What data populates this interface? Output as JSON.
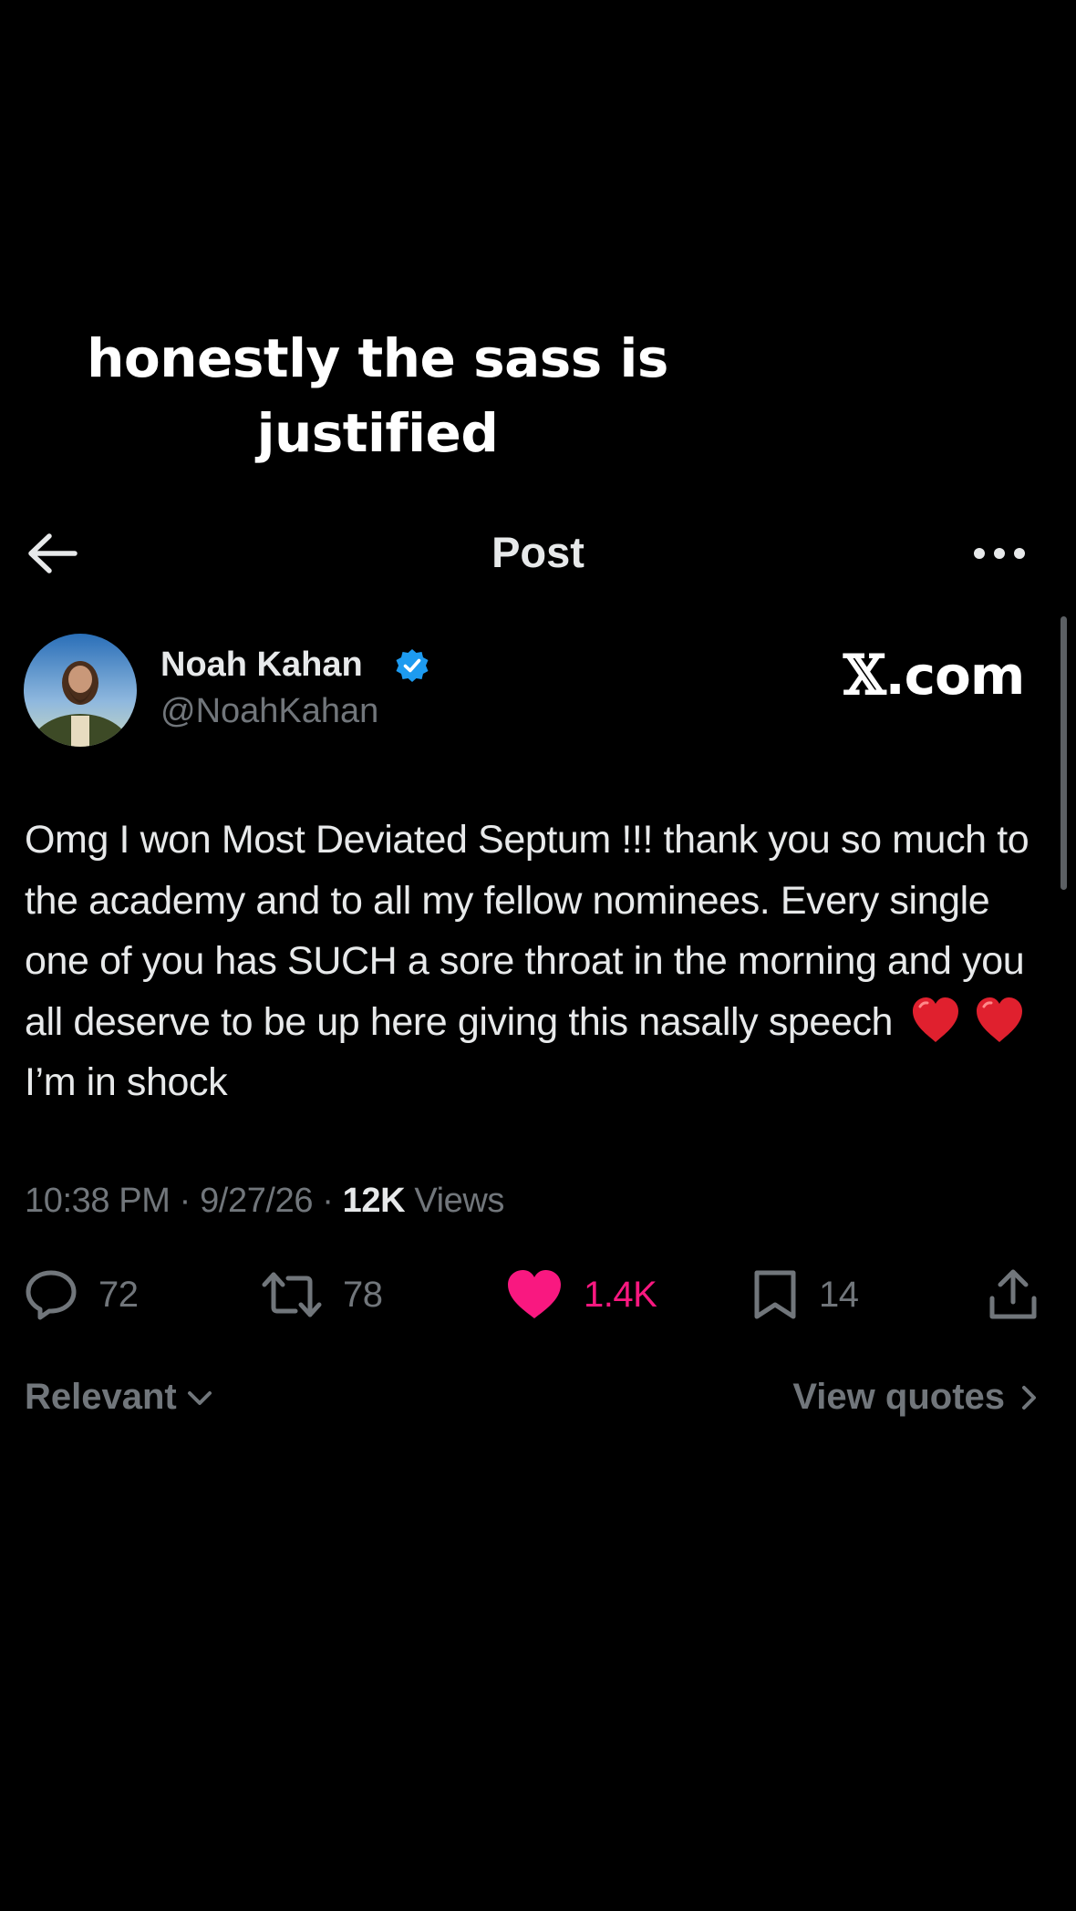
{
  "caption": {
    "line1": "honestly the sass is",
    "line2": "justified"
  },
  "header": {
    "back_icon": "arrow-left-icon",
    "title": "Post",
    "more_icon": "more-horizontal-icon"
  },
  "author": {
    "name": "Noah Kahan",
    "handle": "@NoahKahan",
    "verified": true,
    "verified_color": "#1d9bf0",
    "avatar_icon": "avatar-photo"
  },
  "watermark": {
    "x": "𝕏",
    "dotcom": ".com"
  },
  "tweet": {
    "text_part1": "Omg I won Most Deviated Septum !!! thank you so much to the academy and to all my fellow nominees. Every single one of you has SUCH a sore throat in the morning and you all deserve to be up here giving this nasally speech",
    "emoji": "red-heart-emoji",
    "text_part2": "I’m in shock"
  },
  "meta": {
    "time": "10:38 PM",
    "sep1": "·",
    "date": "9/27/26",
    "sep2": "·",
    "views_count": "12K",
    "views_label": "Views"
  },
  "actions": {
    "replies": {
      "icon": "reply-icon",
      "count": "72"
    },
    "reposts": {
      "icon": "repost-icon",
      "count": "78"
    },
    "likes": {
      "icon": "heart-filled-icon",
      "count": "1.4K",
      "liked": true,
      "color": "#f91880"
    },
    "bookmarks": {
      "icon": "bookmark-icon",
      "count": "14"
    },
    "share": {
      "icon": "share-icon"
    }
  },
  "footer": {
    "sort_label": "Relevant",
    "sort_icon": "chevron-down-icon",
    "quotes_label": "View quotes",
    "quotes_icon": "chevron-right-icon"
  },
  "colors": {
    "background": "#000000",
    "text_primary": "#e7e9ea",
    "text_secondary": "#71767b",
    "like_pink": "#f91880",
    "verified_blue": "#1d9bf0"
  }
}
